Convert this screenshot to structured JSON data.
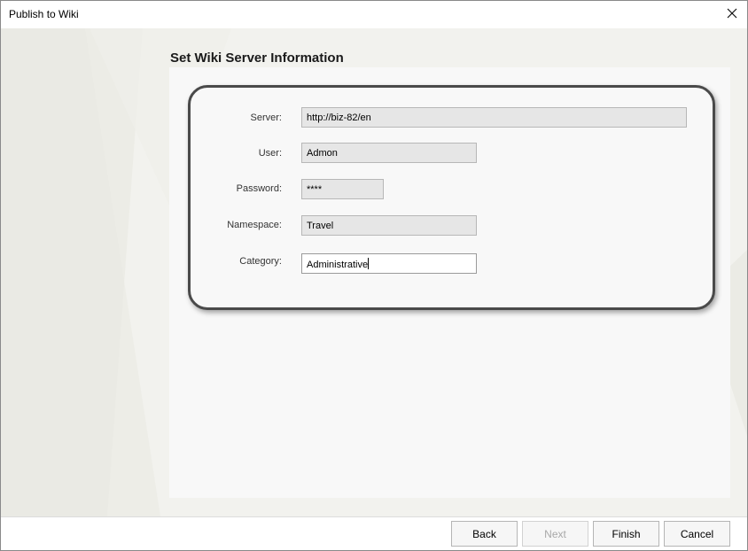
{
  "window": {
    "title": "Publish to Wiki"
  },
  "heading": "Set Wiki Server Information",
  "form": {
    "server": {
      "label": "Server:",
      "value": "http://biz-82/en"
    },
    "user": {
      "label": "User:",
      "value": "Admon"
    },
    "password": {
      "label": "Password:",
      "value": "****"
    },
    "namespace": {
      "label": "Namespace:",
      "value": "Travel"
    },
    "category": {
      "label": "Category:",
      "value": "Administrative"
    }
  },
  "buttons": {
    "back": "Back",
    "next": "Next",
    "finish": "Finish",
    "cancel": "Cancel"
  },
  "icons": {
    "close": "close-icon"
  }
}
